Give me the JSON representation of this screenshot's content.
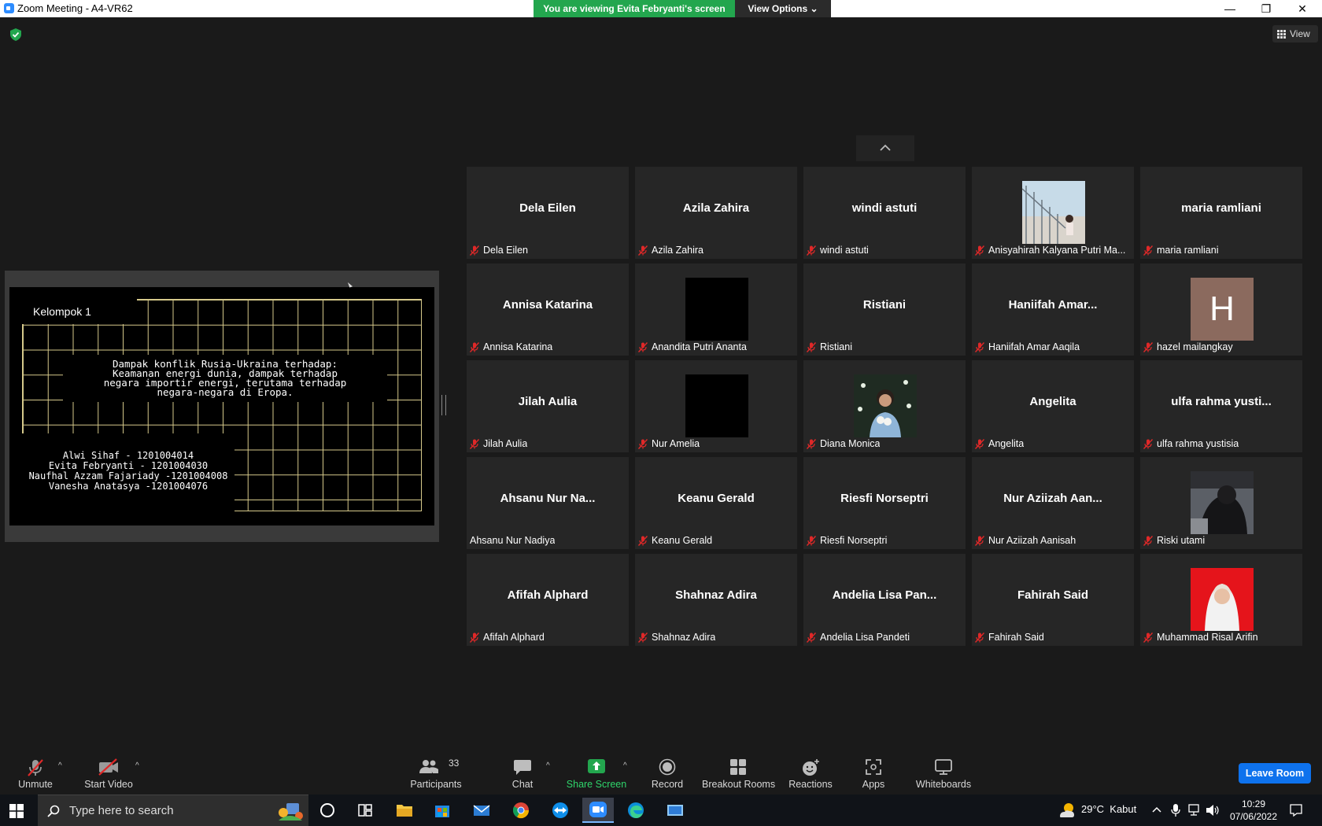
{
  "window": {
    "title": "Zoom Meeting - A4-VR62",
    "viewing_banner": "You are viewing Evita Febryanti's screen",
    "view_options": "View Options",
    "minimize": "—",
    "maximize": "❐",
    "close": "✕"
  },
  "top_right": {
    "view_label": "View"
  },
  "slide": {
    "title": "Kelompok 1",
    "topic_lines": [
      "Dampak konflik Rusia-Ukraina terhadap:",
      "Keamanan energi dunia, dampak terhadap",
      "negara importir energi, terutama terhadap",
      "negara-negara di Eropa."
    ],
    "members": [
      "Alwi Sihaf - 1201004014",
      "Evita Febryanti - 1201004030",
      "Naufhal Azzam Fajariady -1201004008",
      "Vanesha Anatasya -1201004076"
    ]
  },
  "participants": [
    {
      "display": "Dela Eilen",
      "label": "Dela Eilen",
      "muted": true,
      "media": "name"
    },
    {
      "display": "Azila Zahira",
      "label": "Azila Zahira",
      "muted": true,
      "media": "name"
    },
    {
      "display": "windi astuti",
      "label": "windi astuti",
      "muted": true,
      "media": "name"
    },
    {
      "display": "",
      "label": "Anisyahirah Kalyana Putri Ma...",
      "muted": true,
      "media": "photo-stairs"
    },
    {
      "display": "maria ramliani",
      "label": "maria ramliani",
      "muted": true,
      "media": "name"
    },
    {
      "display": "Annisa Katarina",
      "label": "Annisa Katarina",
      "muted": true,
      "media": "name"
    },
    {
      "display": "",
      "label": "Anandita Putri Ananta",
      "muted": true,
      "media": "black"
    },
    {
      "display": "Ristiani",
      "label": "Ristiani",
      "muted": true,
      "media": "name"
    },
    {
      "display": "Haniifah Amar...",
      "label": "Haniifah Amar Aaqila",
      "muted": true,
      "media": "name"
    },
    {
      "display": "H",
      "label": "hazel mailangkay",
      "muted": true,
      "media": "letter"
    },
    {
      "display": "Jilah Aulia",
      "label": "Jilah Aulia",
      "muted": true,
      "media": "name"
    },
    {
      "display": "",
      "label": "Nur Amelia",
      "muted": true,
      "media": "black"
    },
    {
      "display": "",
      "label": "Diana Monica",
      "muted": true,
      "media": "photo-flowers"
    },
    {
      "display": "Angelita",
      "label": "Angelita",
      "muted": true,
      "media": "name"
    },
    {
      "display": "ulfa rahma yusti...",
      "label": "ulfa rahma yustisia",
      "muted": true,
      "media": "name"
    },
    {
      "display": "Ahsanu Nur Na...",
      "label": "Ahsanu Nur Nadiya",
      "muted": false,
      "media": "name"
    },
    {
      "display": "Keanu Gerald",
      "label": "Keanu Gerald",
      "muted": true,
      "media": "name"
    },
    {
      "display": "Riesfi Norseptri",
      "label": "Riesfi Norseptri",
      "muted": true,
      "media": "name"
    },
    {
      "display": "Nur Aziizah Aan...",
      "label": "Nur Aziizah Aanisah",
      "muted": true,
      "media": "name"
    },
    {
      "display": "",
      "label": "Riski utami",
      "muted": true,
      "media": "photo-dark"
    },
    {
      "display": "Afifah Alphard",
      "label": "Afifah Alphard",
      "muted": true,
      "media": "name"
    },
    {
      "display": "Shahnaz Adira",
      "label": "Shahnaz Adira",
      "muted": true,
      "media": "name"
    },
    {
      "display": "Andelia Lisa Pan...",
      "label": "Andelia Lisa Pandeti",
      "muted": true,
      "media": "name"
    },
    {
      "display": "Fahirah Said",
      "label": "Fahirah Said",
      "muted": true,
      "media": "name"
    },
    {
      "display": "",
      "label": "Muhammad Risal Arifin",
      "muted": true,
      "media": "photo-red"
    }
  ],
  "toolbar": {
    "unmute": "Unmute",
    "start_video": "Start Video",
    "participants": "Participants",
    "participant_count": "33",
    "chat": "Chat",
    "share_screen": "Share Screen",
    "record": "Record",
    "breakout_rooms": "Breakout Rooms",
    "reactions": "Reactions",
    "apps": "Apps",
    "whiteboards": "Whiteboards",
    "leave_room": "Leave Room"
  },
  "taskbar": {
    "search_placeholder": "Type here to search",
    "weather": "29°C  Kabut",
    "time": "10:29",
    "date": "07/06/2022"
  },
  "colors": {
    "accent_green": "#23a64e",
    "accent_blue": "#0e72ed",
    "mute_red": "#e02828",
    "background": "#1a1a1a",
    "tile": "#262626"
  }
}
